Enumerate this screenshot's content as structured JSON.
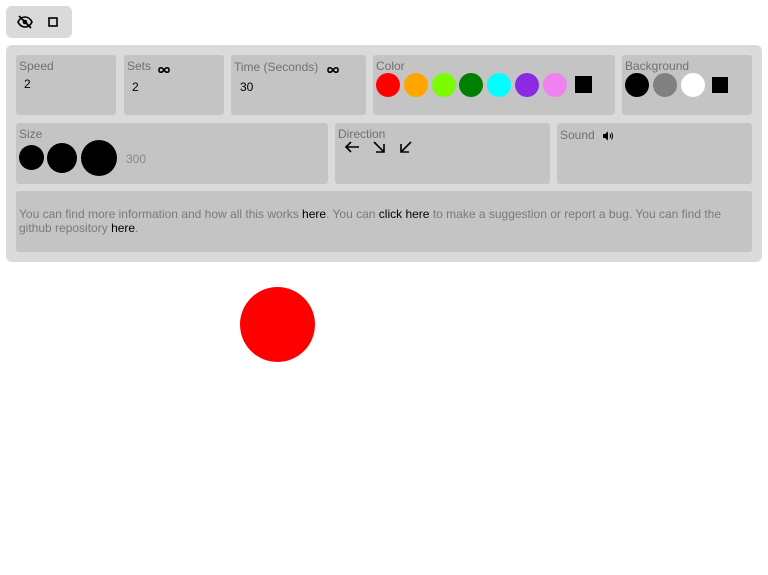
{
  "toolbar": {
    "hide_icon": "eye-off-icon",
    "fullscreen_icon": "square-icon"
  },
  "speed": {
    "label": "Speed",
    "value": "2"
  },
  "sets": {
    "label": "Sets",
    "value": "2",
    "icon": "infinity-icon"
  },
  "time": {
    "label": "Time (Seconds)",
    "value": "30",
    "icon": "infinity-icon"
  },
  "color": {
    "label": "Color",
    "swatches": [
      "#ff0000",
      "#ffa500",
      "#7cfc00",
      "#008000",
      "#00ffff",
      "#8a2be2",
      "#ee82ee"
    ],
    "custom_icon": "square-icon"
  },
  "background": {
    "label": "Background",
    "swatches": [
      "#000000",
      "#808080",
      "#ffffff"
    ],
    "custom_icon": "square-icon"
  },
  "size": {
    "label": "Size",
    "value": "300"
  },
  "direction": {
    "label": "Direction",
    "arrows": [
      "←",
      "↘",
      "↙"
    ]
  },
  "sound": {
    "label": "Sound",
    "icon": "volume-icon"
  },
  "info": {
    "text1": "You can find more information and how all this works ",
    "link1": "here",
    "text2": ". You can ",
    "link2": "click here",
    "text3": " to make a suggestion or report a bug. You can find the github repository ",
    "link3": "here",
    "text4": "."
  },
  "ball": {
    "color": "#ff0000"
  }
}
